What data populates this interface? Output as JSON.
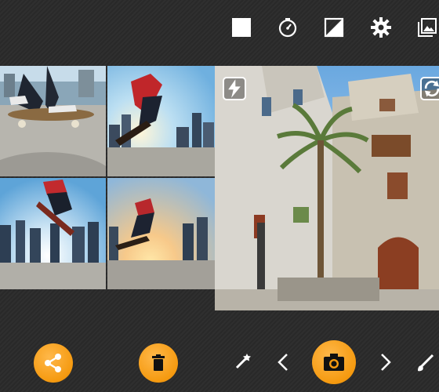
{
  "toolbar": {
    "icons": [
      "stop-square-icon",
      "timer-icon",
      "contrast-icon",
      "settings-gear-icon",
      "gallery-icon"
    ]
  },
  "collage": {
    "tiles": [
      {
        "name": "skateboard-feet"
      },
      {
        "name": "skater-jump-city"
      },
      {
        "name": "skater-flip-city"
      },
      {
        "name": "skater-sunset-jump"
      }
    ]
  },
  "preview": {
    "flash_icon": "flash-auto-icon",
    "switch_icon": "switch-camera-icon"
  },
  "bottom_bar": {
    "icons": [
      "share-icon",
      "trash-icon",
      "magic-wand-icon",
      "chevron-left-icon",
      "camera-icon",
      "chevron-right-icon",
      "brush-icon"
    ]
  },
  "colors": {
    "accent": "#f59a10",
    "background": "#2a2a2a",
    "icon": "#ffffff"
  }
}
